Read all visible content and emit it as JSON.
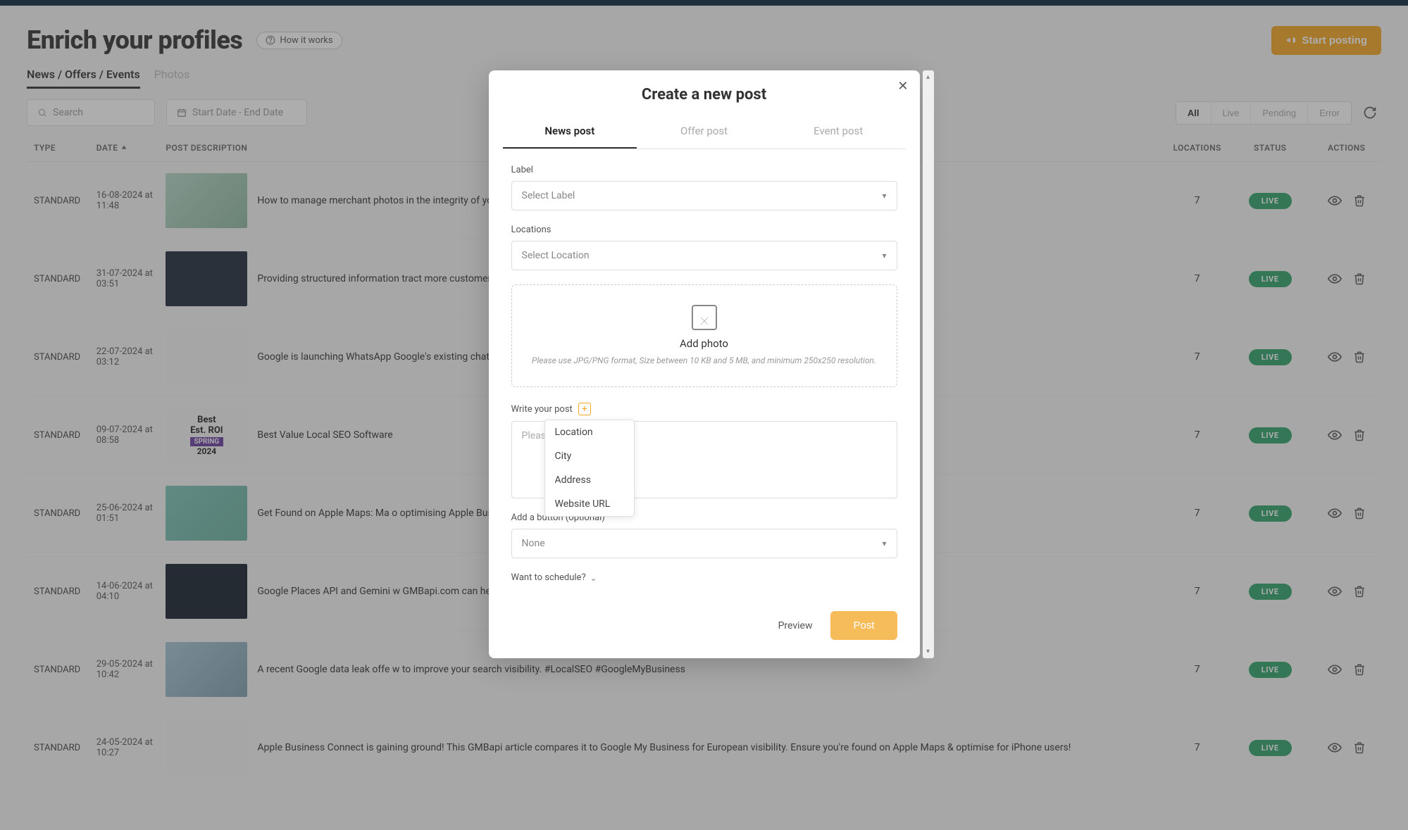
{
  "header": {
    "title": "Enrich your profiles",
    "how_it_works": "How it works",
    "start_posting": "Start posting"
  },
  "main_tabs": {
    "news_offers_events": "News / Offers / Events",
    "photos": "Photos"
  },
  "toolbar": {
    "search_placeholder": "Search",
    "date_range": "Start Date  -  End Date",
    "filters": {
      "all": "All",
      "live": "Live",
      "pending": "Pending",
      "error": "Error"
    }
  },
  "table": {
    "headers": {
      "type": "TYPE",
      "date": "DATE",
      "post_description": "POST DESCRIPTION",
      "locations": "LOCATIONS",
      "status": "STATUS",
      "actions": "ACTIONS"
    },
    "rows": [
      {
        "type": "STANDARD",
        "date": "16-08-2024 at 11:48",
        "desc": "How to manage merchant photos in the integrity of your brand's visual identity",
        "locations": "7",
        "status": "LIVE",
        "thumb": "t1"
      },
      {
        "type": "STANDARD",
        "date": "31-07-2024 at 03:51",
        "desc": "Providing structured information tract more customers to each location.",
        "locations": "7",
        "status": "LIVE",
        "thumb": "t2"
      },
      {
        "type": "STANDARD",
        "date": "22-07-2024 at 03:12",
        "desc": "Google is launching WhatsApp Google's existing chat feature",
        "locations": "7",
        "status": "LIVE",
        "thumb": "t3"
      },
      {
        "type": "STANDARD",
        "date": "09-07-2024 at 08:58",
        "desc": "Best Value Local SEO Software",
        "locations": "7",
        "status": "LIVE",
        "thumb": "t4"
      },
      {
        "type": "STANDARD",
        "date": "25-06-2024 at 01:51",
        "desc": "Get Found on Apple Maps: Ma o optimising Apple Business Connect categories to boost local visibility. #AppleMa",
        "locations": "7",
        "status": "LIVE",
        "thumb": "t5"
      },
      {
        "type": "STANDARD",
        "date": "14-06-2024 at 04:10",
        "desc": "Google Places API and Gemini w GMBapi.com can help you leverage this for better local SEO! #localseo #googlemybus",
        "locations": "7",
        "status": "LIVE",
        "thumb": "t6"
      },
      {
        "type": "STANDARD",
        "date": "29-05-2024 at 10:42",
        "desc": "A recent Google data leak offe w to improve your search visibility. #LocalSEO #GoogleMyBusiness",
        "locations": "7",
        "status": "LIVE",
        "thumb": "t7"
      },
      {
        "type": "STANDARD",
        "date": "24-05-2024 at 10:27",
        "desc": "Apple Business Connect is gaining ground! This GMBapi article compares it to Google My Business for European visibility. Ensure you're found on Apple Maps & optimise for iPhone users!",
        "locations": "7",
        "status": "LIVE",
        "thumb": "t8"
      }
    ]
  },
  "thumb4": {
    "best": "Best",
    "est_roi": "Est. ROI",
    "spring": "SPRING",
    "year": "2024"
  },
  "modal": {
    "title": "Create a new post",
    "tabs": {
      "news": "News post",
      "offer": "Offer post",
      "event": "Event post"
    },
    "label_field": "Label",
    "select_label": "Select Label",
    "locations_field": "Locations",
    "select_location": "Select Location",
    "add_photo": "Add photo",
    "photo_hint": "Please use JPG/PNG format, Size between 10 KB and 5 MB, and minimum 250x250 resolution.",
    "write_label": "Write your post",
    "textarea_placeholder": "Please",
    "add_button": "Add a button (optional)",
    "none": "None",
    "schedule": "Want to schedule?",
    "preview": "Preview",
    "post": "Post",
    "insert_options": {
      "location": "Location",
      "city": "City",
      "address": "Address",
      "website": "Website URL"
    }
  }
}
